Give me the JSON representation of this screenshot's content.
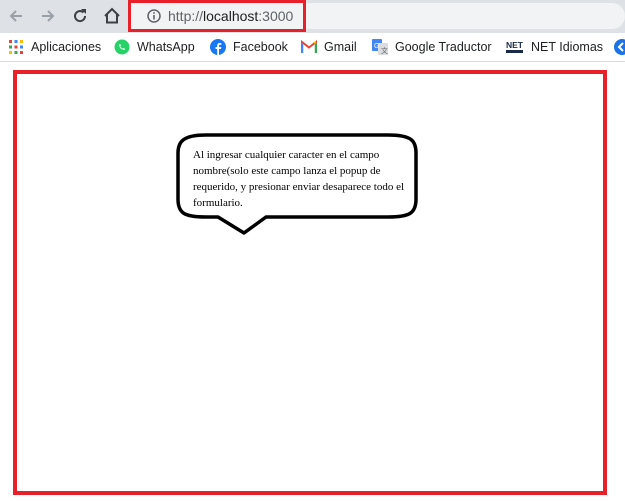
{
  "browser": {
    "url_scheme": "http://",
    "url_host": "localhost",
    "url_port": ":3000"
  },
  "bookmarks": [
    {
      "label": "Aplicaciones",
      "icon": "apps-grid-icon"
    },
    {
      "label": "WhatsApp",
      "icon": "whatsapp-icon"
    },
    {
      "label": "Facebook",
      "icon": "facebook-icon"
    },
    {
      "label": "Gmail",
      "icon": "gmail-icon"
    },
    {
      "label": "Google Traductor",
      "icon": "google-translate-icon"
    },
    {
      "label": "NET Idiomas",
      "icon": "net-idiomas-icon"
    }
  ],
  "annotation": {
    "text": "Al ingresar cualquier caracter en el campo nombre(solo este campo lanza el popup de requerido, y presionar enviar desaparece todo el formulario."
  },
  "colors": {
    "highlight": "#e8202a",
    "toolbar": "#dee1e6"
  }
}
